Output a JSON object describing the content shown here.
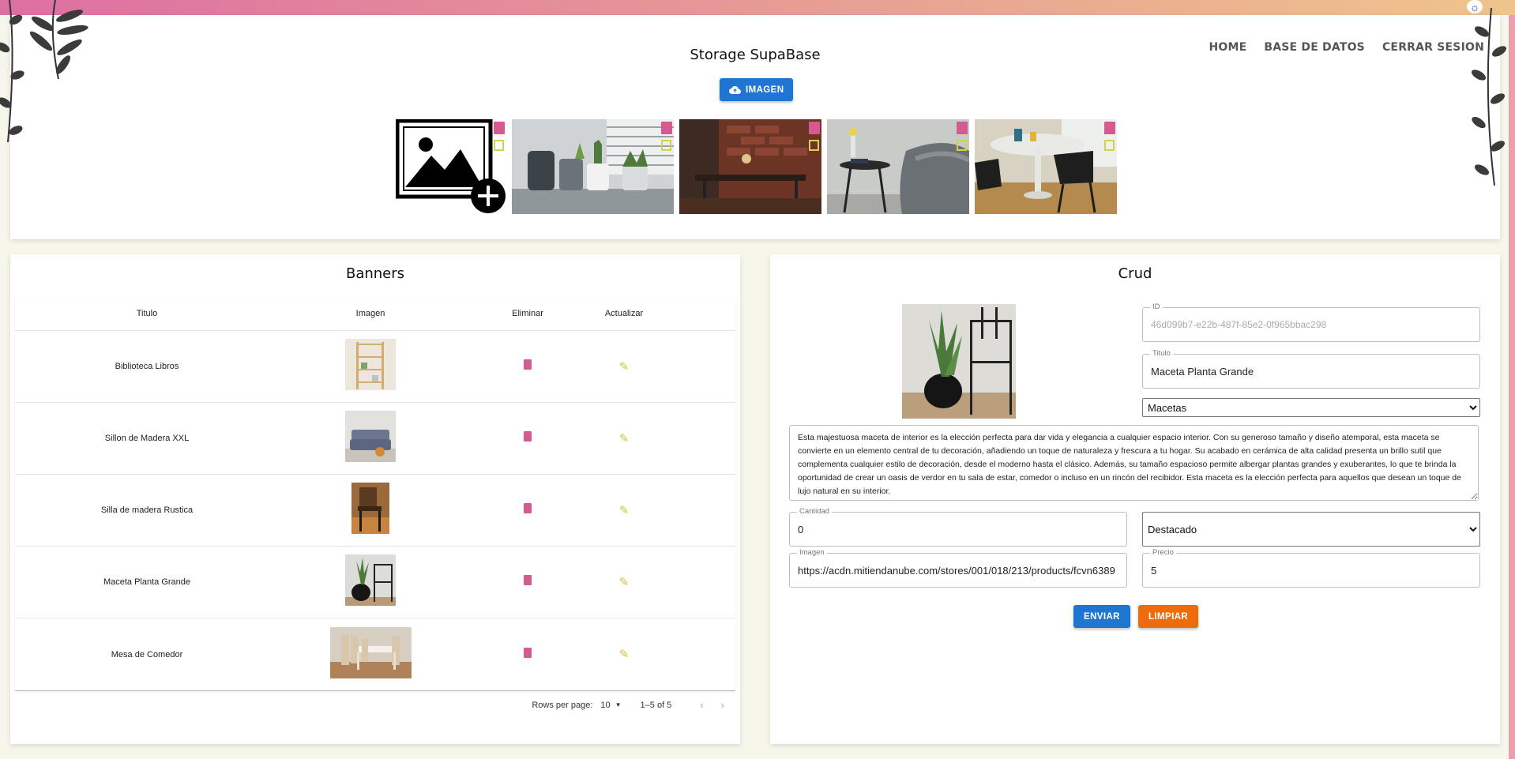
{
  "colors": {
    "primary": "#1f76d2",
    "secondary": "#ee6c0c",
    "delete": "#d55a90",
    "edit": "#d3c13a"
  },
  "nav": {
    "home": "HOME",
    "database": "BASE DE DATOS",
    "logout": "CERRAR SESION"
  },
  "storage": {
    "title": "Storage SupaBase",
    "upload_label": "IMAGEN",
    "images": [
      {
        "name": "add-image-placeholder",
        "icon": "image-plus-icon"
      },
      {
        "name": "storage-image-cactus-shelf"
      },
      {
        "name": "storage-image-brick-dining"
      },
      {
        "name": "storage-image-side-table"
      },
      {
        "name": "storage-image-round-table"
      }
    ]
  },
  "banners": {
    "title": "Banners",
    "columns": [
      "Titulo",
      "Imagen",
      "Eliminar",
      "Actualizar"
    ],
    "rows": [
      {
        "titulo": "Biblioteca Libros"
      },
      {
        "titulo": "Sillon de Madera XXL"
      },
      {
        "titulo": "Silla de madera Rustica"
      },
      {
        "titulo": "Maceta Planta Grande"
      },
      {
        "titulo": "Mesa de Comedor"
      }
    ],
    "pagination": {
      "rows_per_page_label": "Rows per page:",
      "rows_per_page": "10",
      "range": "1–5 of 5"
    }
  },
  "crud": {
    "title": "Crud",
    "id": {
      "label": "ID",
      "value": "46d099b7-e22b-487f-85e2-0f965bbac298"
    },
    "titulo": {
      "label": "Titulo",
      "value": "Maceta Planta Grande"
    },
    "categoria": {
      "selected": "Macetas"
    },
    "descripcion": "Esta majestuosa maceta de interior es la elección perfecta para dar vida y elegancia a cualquier espacio interior. Con su generoso tamaño y diseño atemporal, esta maceta se convierte en un elemento central de tu decoración, añadiendo un toque de naturaleza y frescura a tu hogar. Su acabado en cerámica de alta calidad presenta un brillo sutil que complementa cualquier estilo de decoración, desde el moderno hasta el clásico. Además, su tamaño espacioso permite albergar plantas grandes y exuberantes, lo que te brinda la oportunidad de crear un oasis de verdor en tu sala de estar, comedor o incluso en un rincón del recibidor. Esta maceta es la elección perfecta para aquellos que desean un toque de lujo natural en su interior.",
    "cantidad": {
      "label": "Cantidad",
      "value": "0"
    },
    "estado": {
      "selected": "Destacado"
    },
    "imagen": {
      "label": "Imagen",
      "value": "https://acdn.mitiendanube.com/stores/001/018/213/products/fcvn6389"
    },
    "precio": {
      "label": "Precio",
      "value": "5"
    },
    "send_label": "ENVIAR",
    "clear_label": "LIMPIAR"
  }
}
